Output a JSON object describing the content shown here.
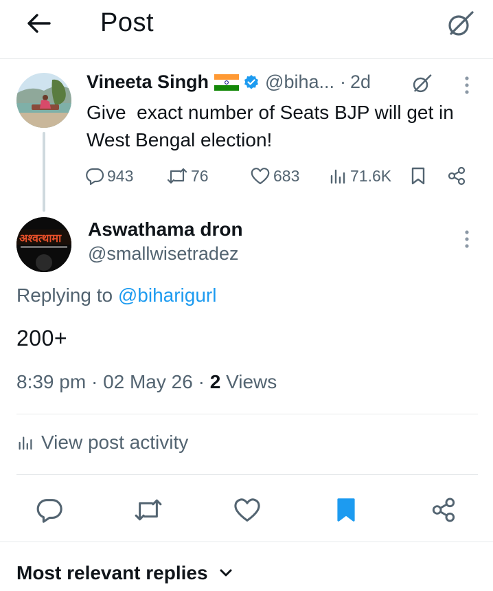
{
  "header": {
    "title": "Post"
  },
  "parent_post": {
    "author_name": "Vineeta Singh",
    "handle": "@biha...",
    "separator": "·",
    "time_ago": "2d",
    "text": "Give  exact number of Seats BJP will get in West Bengal election!",
    "stats": {
      "replies": "943",
      "reposts": "76",
      "likes": "683",
      "views": "71.6K"
    }
  },
  "reply_post": {
    "author_name": "Aswathama dron",
    "handle": "@smallwisetradez",
    "replying_prefix": "Replying to ",
    "replying_to": "@biharigurl",
    "text": "200+",
    "time": "8:39 pm",
    "date": "02 May 26",
    "views_count": "2",
    "views_label": "Views",
    "activity_label": "View post activity"
  },
  "replies_sort": {
    "label": "Most relevant replies"
  },
  "colors": {
    "accent": "#1d9bf0",
    "secondary_text": "#536471",
    "divider": "#e6e9eb",
    "verified": "#1d9bf0"
  },
  "icons": {
    "back": "arrow-left-icon",
    "grok": "grok-icon",
    "more": "more-vertical-icon",
    "reply": "reply-icon",
    "repost": "repost-icon",
    "like": "heart-icon",
    "views": "views-icon",
    "bookmark": "bookmark-icon",
    "share": "share-icon",
    "chevron": "chevron-down-icon"
  }
}
